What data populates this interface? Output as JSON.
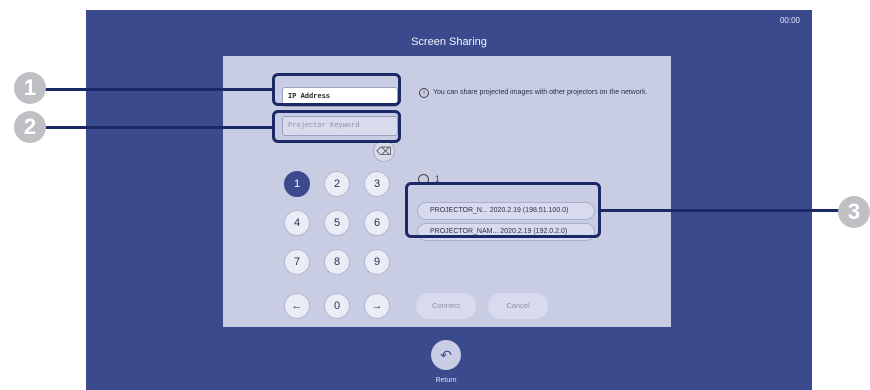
{
  "header": {
    "clock": "00:00",
    "title": "Screen Sharing"
  },
  "form": {
    "ip_placeholder": "IP Address",
    "keyword_placeholder": "Projector Keyword",
    "info_text": "You can share projected images with other projectors on the network."
  },
  "keypad": {
    "keys": [
      "1",
      "2",
      "3",
      "4",
      "5",
      "6",
      "7",
      "8",
      "9",
      "←",
      "0",
      "→"
    ],
    "selected": "1",
    "backspace": "⌫"
  },
  "history": {
    "count": "1",
    "items": [
      {
        "label": "PROJECTOR_N...  2020.2.19 (198.51.100.0)"
      },
      {
        "label": "PROJECTOR_NAM...  2020.2.19 (192.0.2.0)"
      }
    ]
  },
  "buttons": {
    "connect": "Connect",
    "cancel": "Cancel"
  },
  "footer": {
    "return_label": "Return"
  },
  "callouts": [
    "1",
    "2",
    "3"
  ],
  "colors": {
    "background": "#3b4a8c",
    "panel": "#c9cde3",
    "callout": "#1b2a66",
    "badge": "#bfc0c4"
  }
}
